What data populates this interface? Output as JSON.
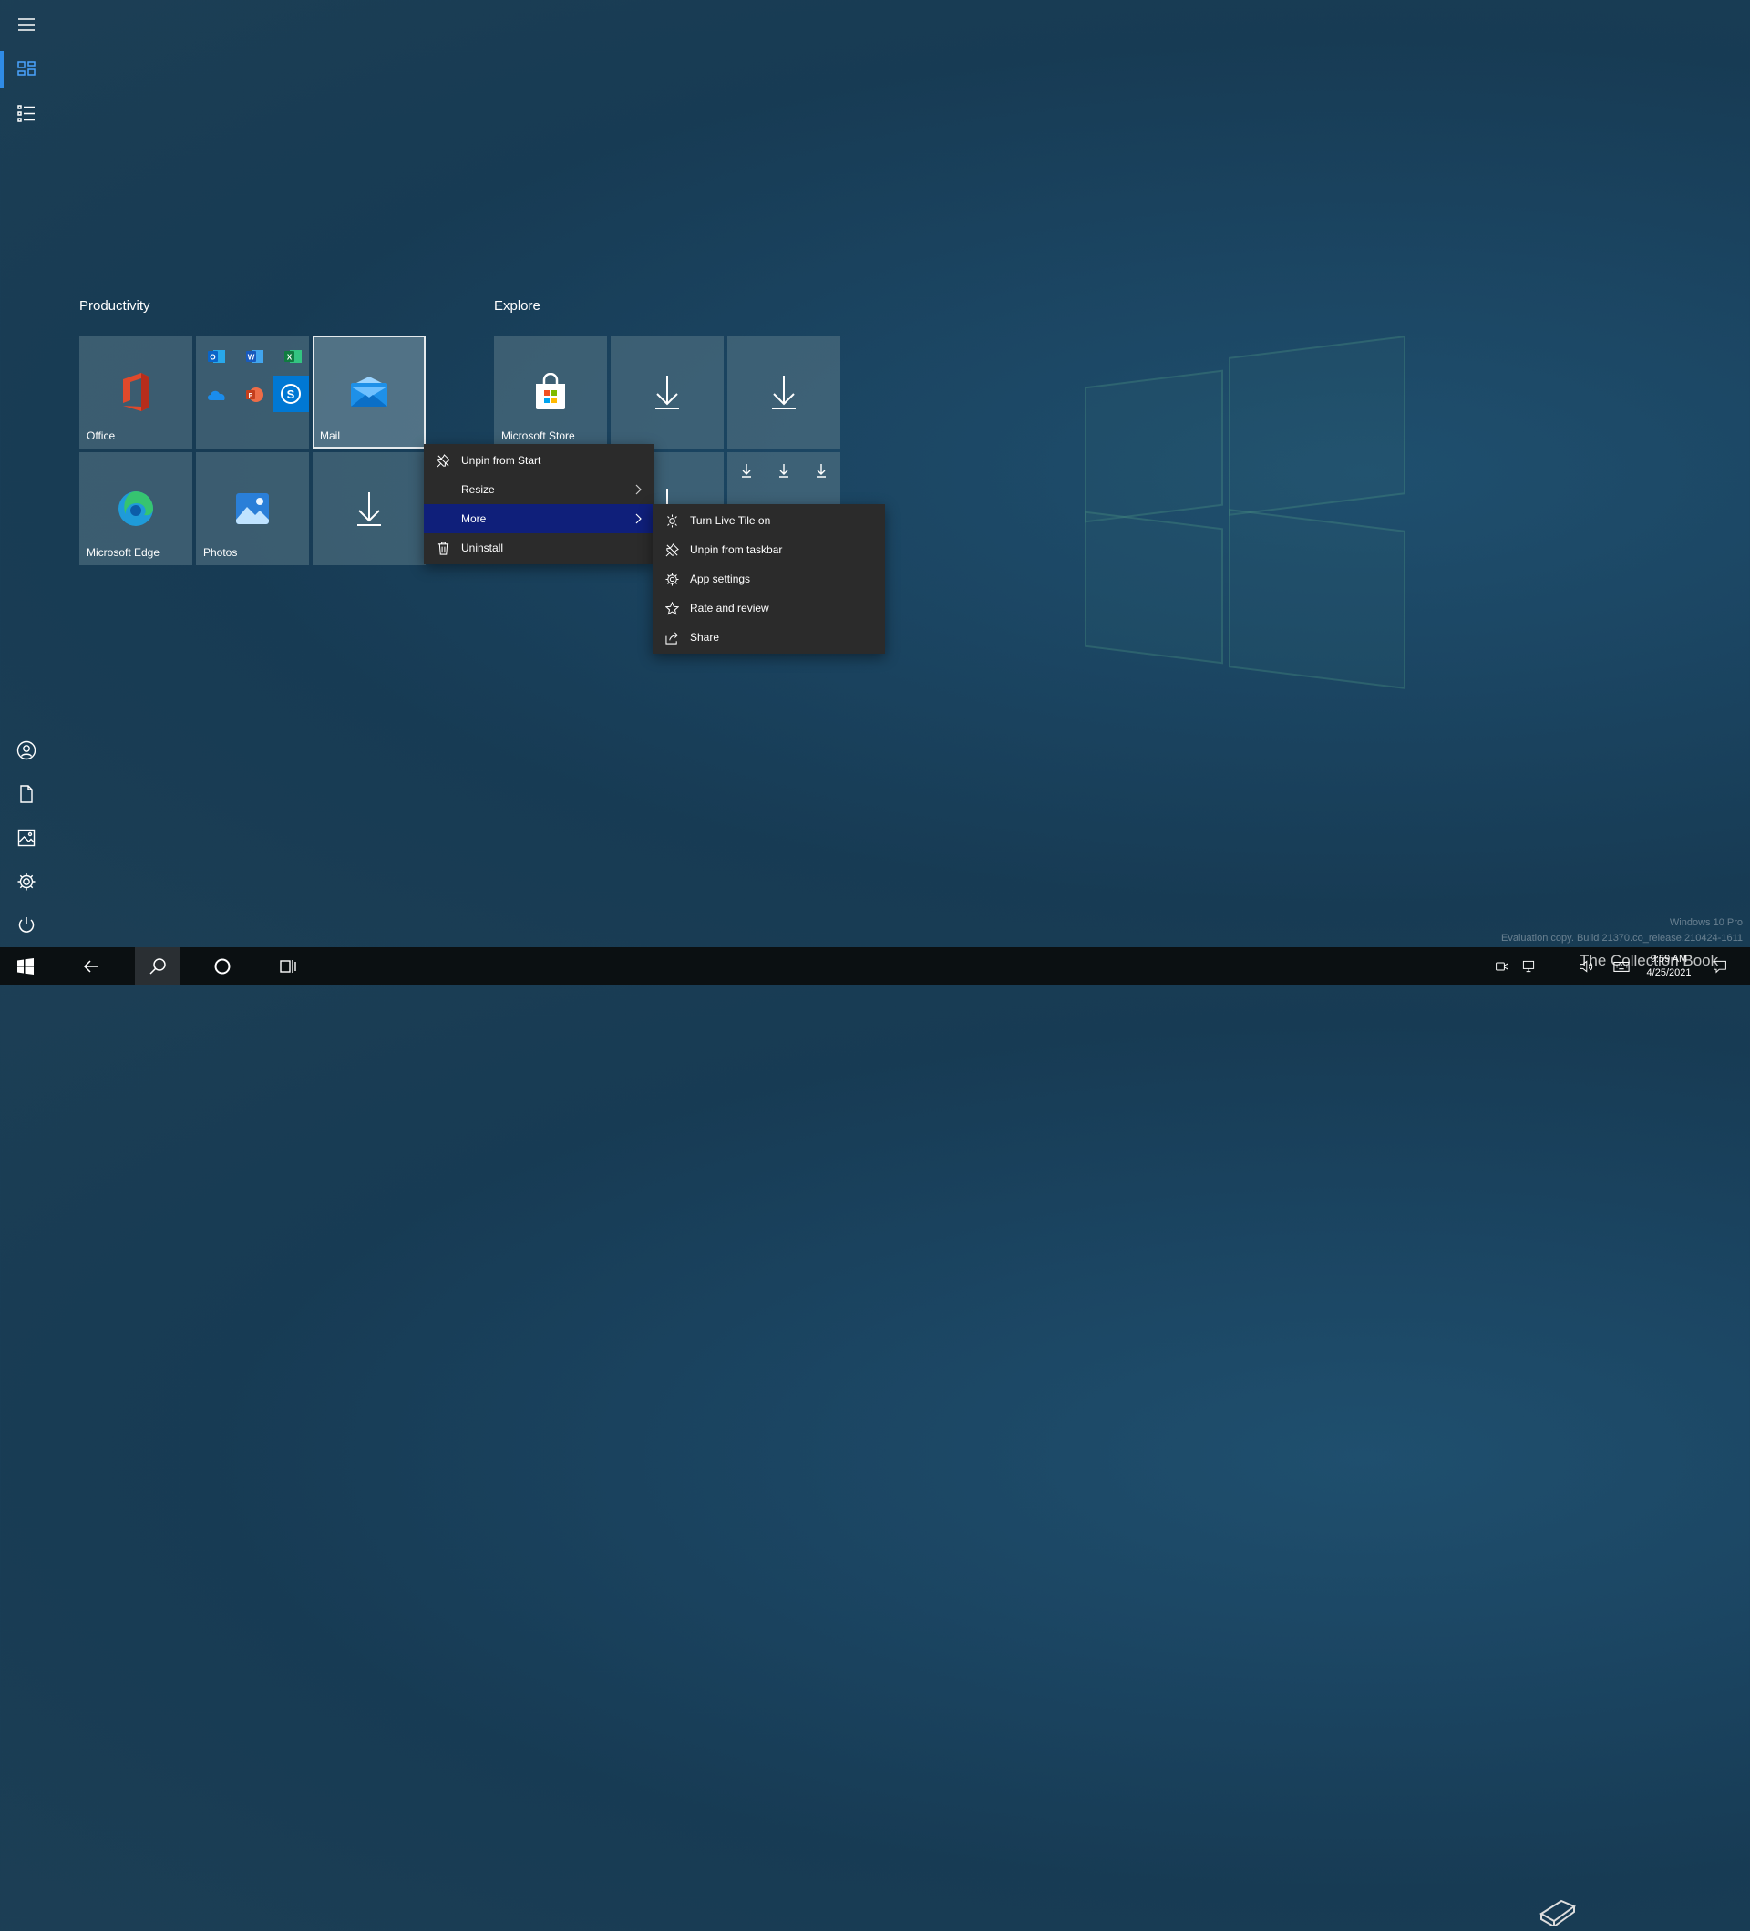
{
  "start_menu": {
    "groups": [
      {
        "title": "Productivity"
      },
      {
        "title": "Explore"
      }
    ],
    "tiles": {
      "office": "Office",
      "mail": "Mail",
      "edge": "Microsoft Edge",
      "photos": "Photos",
      "store": "Microsoft Store"
    }
  },
  "context_menu": {
    "items": [
      {
        "label": "Unpin from Start",
        "icon": "unpin-icon"
      },
      {
        "label": "Resize",
        "icon": ""
      },
      {
        "label": "More",
        "icon": ""
      },
      {
        "label": "Uninstall",
        "icon": "trash-icon"
      }
    ]
  },
  "submenu": {
    "items": [
      {
        "label": "Turn Live Tile on",
        "icon": "sun-icon"
      },
      {
        "label": "Unpin from taskbar",
        "icon": "unpin-icon"
      },
      {
        "label": "App settings",
        "icon": "gear-icon"
      },
      {
        "label": "Rate and review",
        "icon": "star-icon"
      },
      {
        "label": "Share",
        "icon": "share-icon"
      }
    ]
  },
  "watermark": {
    "line1": "Windows 10 Pro",
    "line2": "Evaluation copy. Build 21370.co_release.210424-1611"
  },
  "clock": {
    "time": "9:59 AM",
    "date": "4/25/2021"
  },
  "overlay_logo_text": "The Collection Book",
  "colors": {
    "menu_bg": "#2b2b2b",
    "highlight": "#0f1f7a",
    "accent": "#2f8be6"
  }
}
